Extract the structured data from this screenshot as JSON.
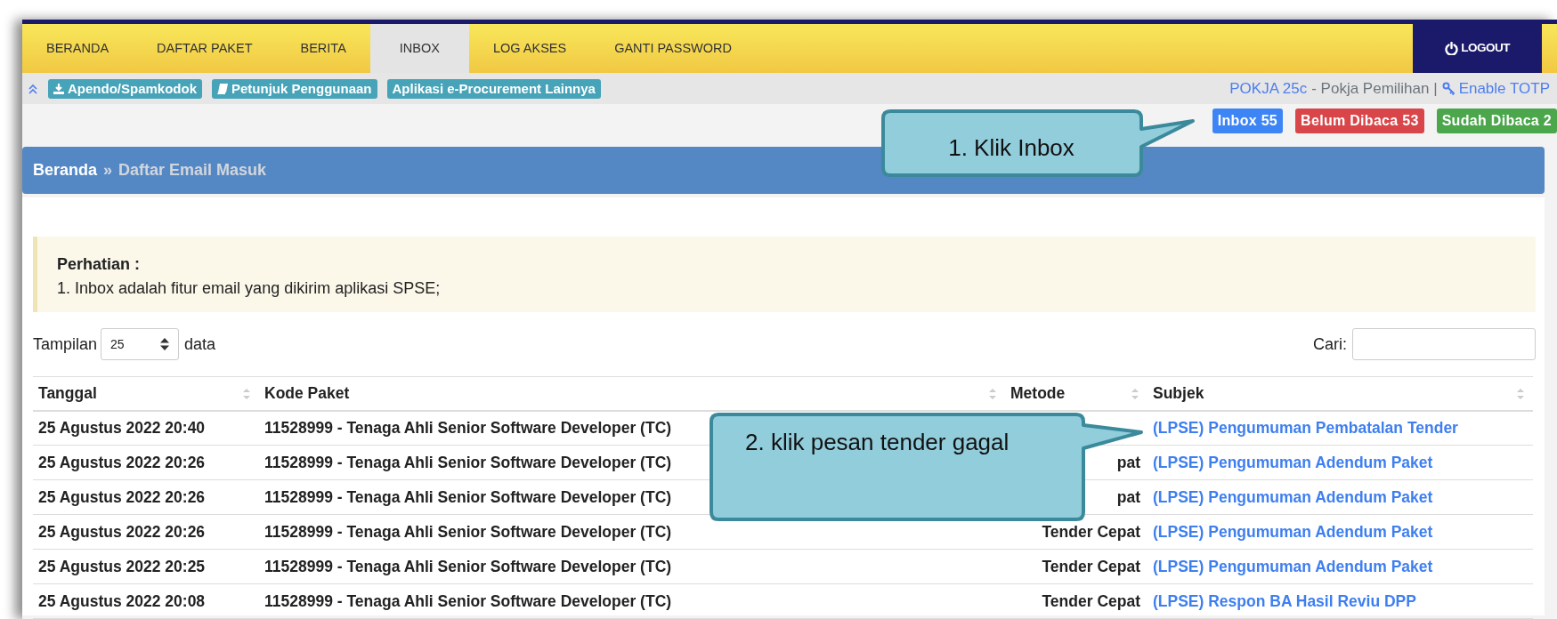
{
  "nav": {
    "items": [
      {
        "label": "BERANDA",
        "selected": false
      },
      {
        "label": "DAFTAR PAKET",
        "selected": false
      },
      {
        "label": "BERITA",
        "selected": false
      },
      {
        "label": "INBOX",
        "selected": true
      },
      {
        "label": "LOG AKSES",
        "selected": false
      },
      {
        "label": "GANTI PASSWORD",
        "selected": false
      }
    ],
    "logout": "LOGOUT"
  },
  "toolbar": {
    "buttons": [
      {
        "label": "Apendo/Spamkodok",
        "kind": "download"
      },
      {
        "label": "Petunjuk Penggunaan",
        "kind": "book"
      },
      {
        "label": "Aplikasi e-Procurement Lainnya",
        "kind": "plain"
      }
    ],
    "user": "POKJA 25c",
    "role": "- Pokja Pemilihan |",
    "totp": "Enable TOTP"
  },
  "badges": [
    {
      "label": "Inbox 55",
      "color": "#3d85f5"
    },
    {
      "label": "Belum Dibaca 53",
      "color": "#d9464a"
    },
    {
      "label": "Sudah Dibaca 2",
      "color": "#4ca64c"
    }
  ],
  "breadcrumb": {
    "home": "Beranda",
    "separator": "»",
    "current": "Daftar Email Masuk"
  },
  "notice": {
    "title": "Perhatian :",
    "lines": [
      "1. Inbox adalah fitur email yang dikirim aplikasi SPSE;"
    ]
  },
  "length": {
    "before": "Tampilan",
    "value": "25",
    "after": "data"
  },
  "search": {
    "label": "Cari:"
  },
  "table": {
    "columns": [
      "Tanggal",
      "Kode Paket",
      "Metode",
      "Subjek"
    ],
    "rows": [
      {
        "tanggal": "25 Agustus 2022 20:40",
        "kode": "11528999 - Tenaga Ahli Senior Software Developer (TC)",
        "subjek": "(LPSE) Pengumuman Pembatalan Tender"
      },
      {
        "tanggal": "25 Agustus 2022 20:26",
        "kode": "11528999 - Tenaga Ahli Senior Software Developer (TC)",
        "metode": "pat",
        "subjek": "(LPSE) Pengumuman Adendum Paket"
      },
      {
        "tanggal": "25 Agustus 2022 20:26",
        "kode": "11528999 - Tenaga Ahli Senior Software Developer (TC)",
        "metode": "pat",
        "subjek": "(LPSE) Pengumuman Adendum Paket"
      },
      {
        "tanggal": "25 Agustus 2022 20:26",
        "kode": "11528999 - Tenaga Ahli Senior Software Developer (TC)",
        "metode": "Tender Cepat",
        "subjek": "(LPSE) Pengumuman Adendum Paket"
      },
      {
        "tanggal": "25 Agustus 2022 20:25",
        "kode": "11528999 - Tenaga Ahli Senior Software Developer (TC)",
        "metode": "Tender Cepat",
        "subjek": "(LPSE) Pengumuman Adendum Paket"
      },
      {
        "tanggal": "25 Agustus 2022 20:08",
        "kode": "11528999 - Tenaga Ahli Senior Software Developer (TC)",
        "metode": "Tender Cepat",
        "subjek": "(LPSE) Respon BA Hasil Reviu DPP"
      }
    ]
  },
  "callouts": [
    {
      "text": "1. Klik Inbox"
    },
    {
      "text": "2. klik pesan tender gagal"
    }
  ]
}
